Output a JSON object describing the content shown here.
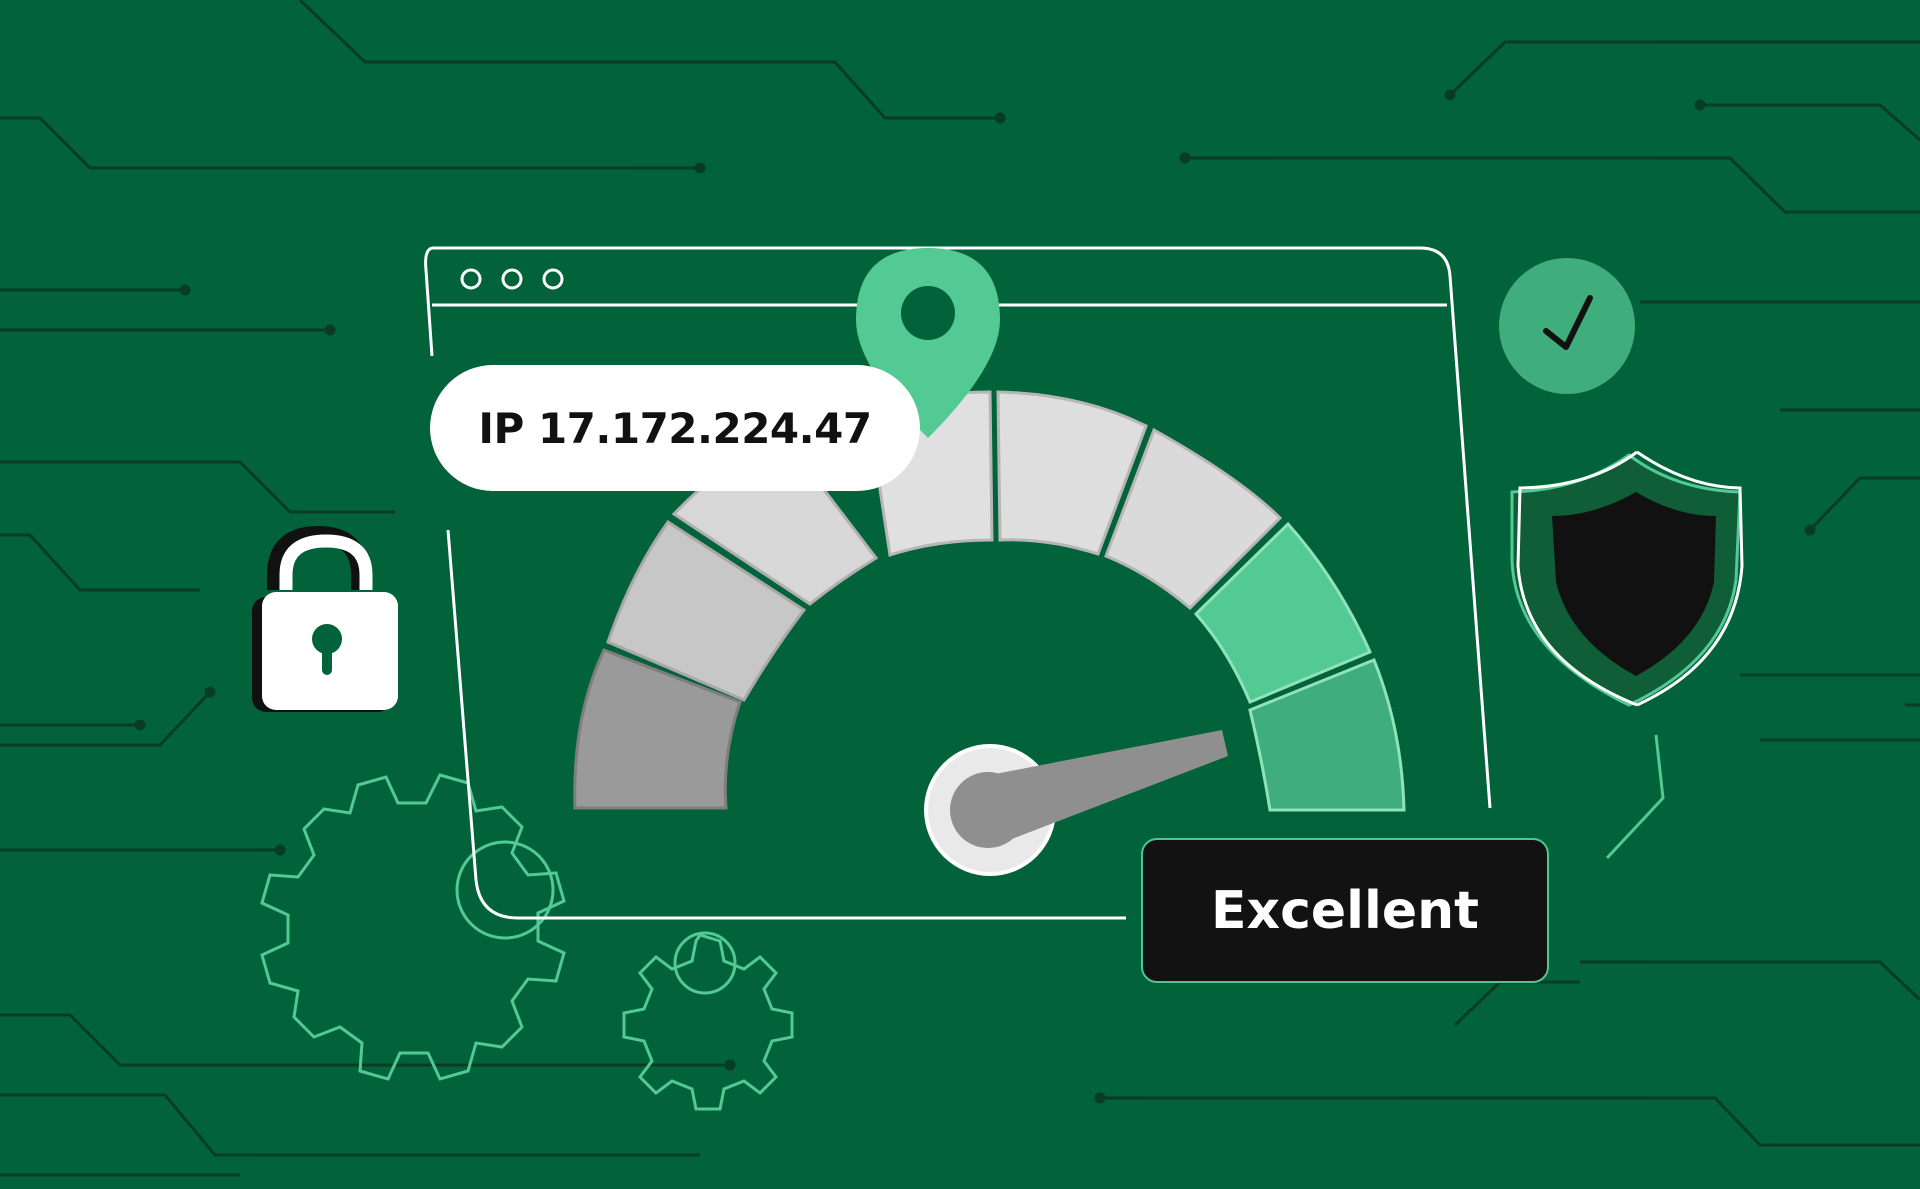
{
  "ip_label": "IP 17.172.224.47",
  "rating_label": "Excellent",
  "gauge": {
    "segments": 8,
    "filled_segments": 2,
    "needle_level": 0.9
  },
  "colors": {
    "background": "#02633a",
    "accent_green": "#53c993",
    "accent_green_dark": "#3fae7c",
    "segment_gray": "#d9d9d9",
    "segment_gray_dark": "#9a9a9a",
    "label_dark": "#121212",
    "white": "#ffffff"
  },
  "icons": [
    "window-dots-icon",
    "location-pin-icon",
    "lock-icon",
    "checkmark-circle-icon",
    "shield-icon",
    "gear-icon"
  ]
}
